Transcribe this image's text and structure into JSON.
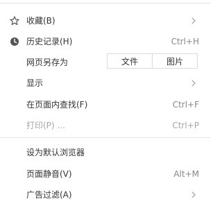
{
  "menu": {
    "items": [
      {
        "label": "收藏(B)",
        "icon": "star-icon",
        "submenu": true
      },
      {
        "label": "历史记录(H)",
        "icon": "clock-icon",
        "shortcut": "Ctrl+H"
      },
      {
        "label": "网页另存为",
        "buttons": [
          "文件",
          "图片"
        ]
      },
      {
        "label": "显示",
        "submenu": true
      },
      {
        "label": "在页面内查找(F)",
        "shortcut": "Ctrl+F"
      },
      {
        "label": "打印(P) ...",
        "shortcut": "Ctrl+P",
        "disabled": true
      },
      {
        "label": "设为默认浏览器"
      },
      {
        "label": "页面静音(V)",
        "shortcut": "Alt+M"
      },
      {
        "label": "广告过滤(A)",
        "submenu": true
      }
    ]
  },
  "colors": {
    "text": "#333333",
    "shortcut": "#888888",
    "disabled": "#a6a6a6",
    "separator": "#e6e6e6",
    "icon": "#555555"
  }
}
